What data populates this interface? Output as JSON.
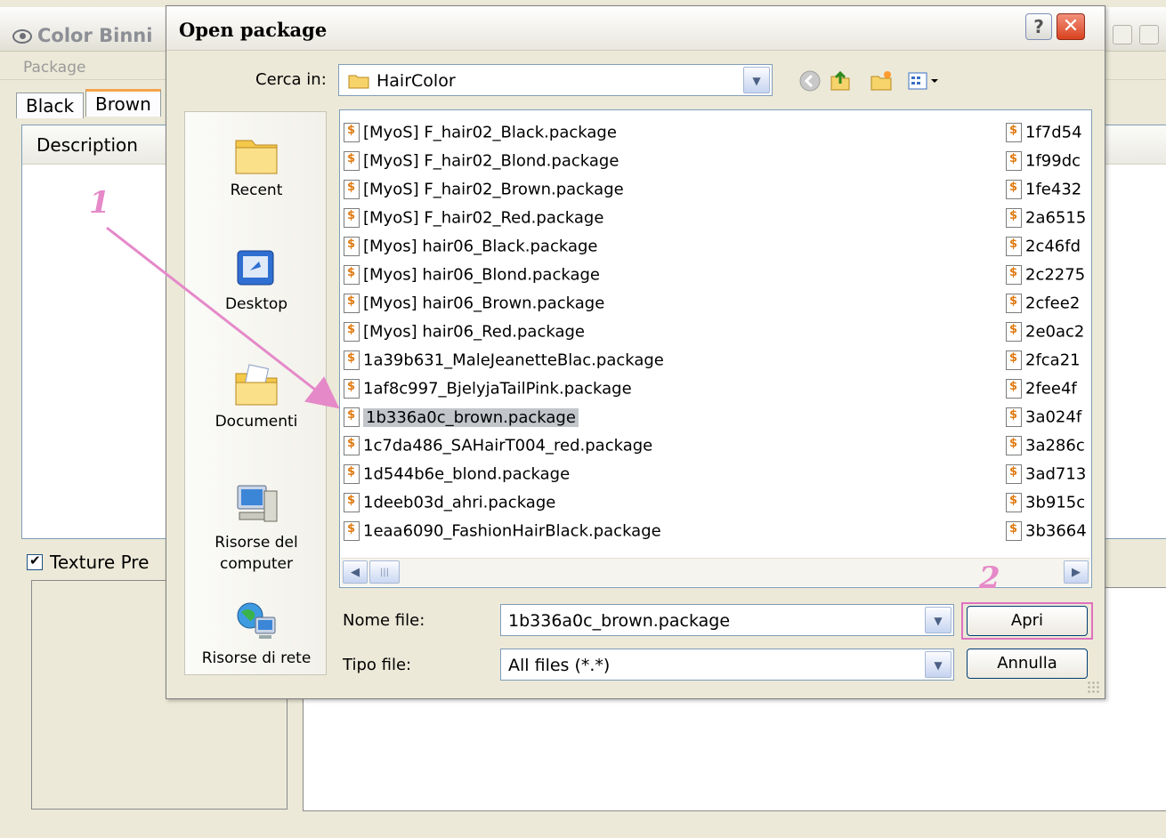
{
  "background_app": {
    "title": "Color Binni",
    "menu_item": "Package",
    "tabs": [
      "Black",
      "Brown"
    ],
    "column_header": "Description",
    "texture_checkbox_label": "Texture Pre",
    "texture_checked": true
  },
  "dialog": {
    "title": "Open package",
    "help_label": "?",
    "look_in_label": "Cerca in:",
    "look_in_value": "HairColor",
    "places": [
      {
        "label": "Recent",
        "icon": "recent-folder-icon"
      },
      {
        "label": "Desktop",
        "icon": "desktop-icon"
      },
      {
        "label": "Documenti",
        "icon": "documents-folder-icon"
      },
      {
        "label": "Risorse del computer",
        "icon": "my-computer-icon"
      },
      {
        "label": "Risorse di rete",
        "icon": "network-icon"
      }
    ],
    "files_col1": [
      "[MyoS] F_hair02_Black.package",
      "[MyoS] F_hair02_Blond.package",
      "[MyoS] F_hair02_Brown.package",
      "[MyoS] F_hair02_Red.package",
      "[Myos] hair06_Black.package",
      "[Myos] hair06_Blond.package",
      "[Myos] hair06_Brown.package",
      "[Myos] hair06_Red.package",
      "1a39b631_MaleJeanetteBlac.package",
      "1af8c997_BjelyjaTailPink.package",
      "1b336a0c_brown.package",
      "1c7da486_SAHairT004_red.package",
      "1d544b6e_blond.package",
      "1deeb03d_ahri.package",
      "1eaa6090_FashionHairBlack.package"
    ],
    "files_col2": [
      "1f7d54",
      "1f99dc",
      "1fe432",
      "2a6515",
      "2c46fd",
      "2c2275",
      "2cfee2",
      "2e0ac2",
      "2fca21",
      "2fee4f",
      "3a024f",
      "3a286c",
      "3ad713",
      "3b915c",
      "3b3664"
    ],
    "selected_index": 10,
    "filename_label": "Nome file:",
    "filename_value": "1b336a0c_brown.package",
    "filetype_label": "Tipo file:",
    "filetype_value": "All files (*.*)",
    "open_button": "Apri",
    "cancel_button": "Annulla"
  },
  "annotations": {
    "step1": "1",
    "step2": "2",
    "color": "#e589c9"
  }
}
